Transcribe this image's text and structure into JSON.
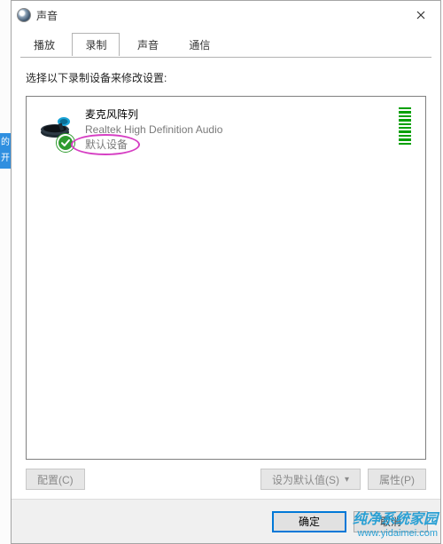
{
  "titlebar": {
    "title": "声音"
  },
  "tabs": [
    {
      "label": "播放",
      "active": false
    },
    {
      "label": "录制",
      "active": true
    },
    {
      "label": "声音",
      "active": false
    },
    {
      "label": "通信",
      "active": false
    }
  ],
  "instruction": "选择以下录制设备来修改设置:",
  "devices": [
    {
      "name": "麦克风阵列",
      "driver": "Realtek High Definition Audio",
      "status": "默认设备",
      "is_default": true,
      "level_bars": 10
    }
  ],
  "buttons": {
    "configure": "配置(C)",
    "set_default": "设为默认值(S)",
    "properties": "属性(P)",
    "ok": "确定",
    "cancel": "取消"
  },
  "watermark": {
    "cn": "纯净系统家园",
    "url": "www.yidaimei.com"
  },
  "sliver": {
    "char1": "的",
    "char2": "开"
  }
}
